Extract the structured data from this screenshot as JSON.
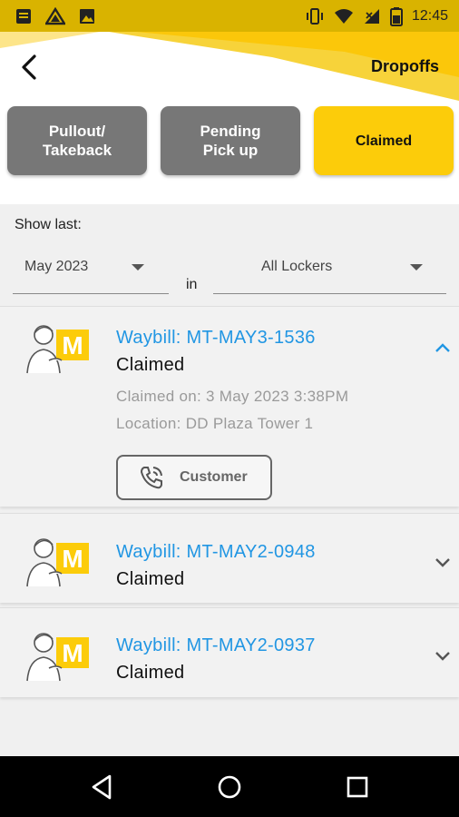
{
  "status_bar": {
    "time": "12:45"
  },
  "header": {
    "title": "Dropoffs"
  },
  "tabs": [
    {
      "label_line1": "Pullout/",
      "label_line2": "Takeback",
      "active": false
    },
    {
      "label_line1": "Pending",
      "label_line2": "Pick up",
      "active": false
    },
    {
      "label": "Claimed",
      "active": true
    }
  ],
  "filters": {
    "show_last_label": "Show last:",
    "period_value": "May 2023",
    "in_label": "in",
    "locker_value": "All Lockers"
  },
  "items": [
    {
      "waybill": "Waybill: MT-MAY3-1536",
      "status": "Claimed",
      "claimed_on": "Claimed on: 3 May 2023 3:38PM",
      "location": "Location: DD Plaza Tower 1",
      "customer_button": "Customer",
      "expanded": true
    },
    {
      "waybill": "Waybill: MT-MAY2-0948",
      "status": "Claimed",
      "expanded": false
    },
    {
      "waybill": "Waybill: MT-MAY2-0937",
      "status": "Claimed",
      "expanded": false
    }
  ],
  "colors": {
    "accent": "#fccc0a",
    "status_bar": "#d9b300",
    "tab_inactive": "#777777",
    "link_blue": "#2196e3"
  },
  "icons": {
    "back": "arrow-left-icon",
    "avatar": "courier-m-icon",
    "expand": "chevron-down-icon",
    "collapse": "chevron-up-icon",
    "phone": "phone-call-icon"
  }
}
